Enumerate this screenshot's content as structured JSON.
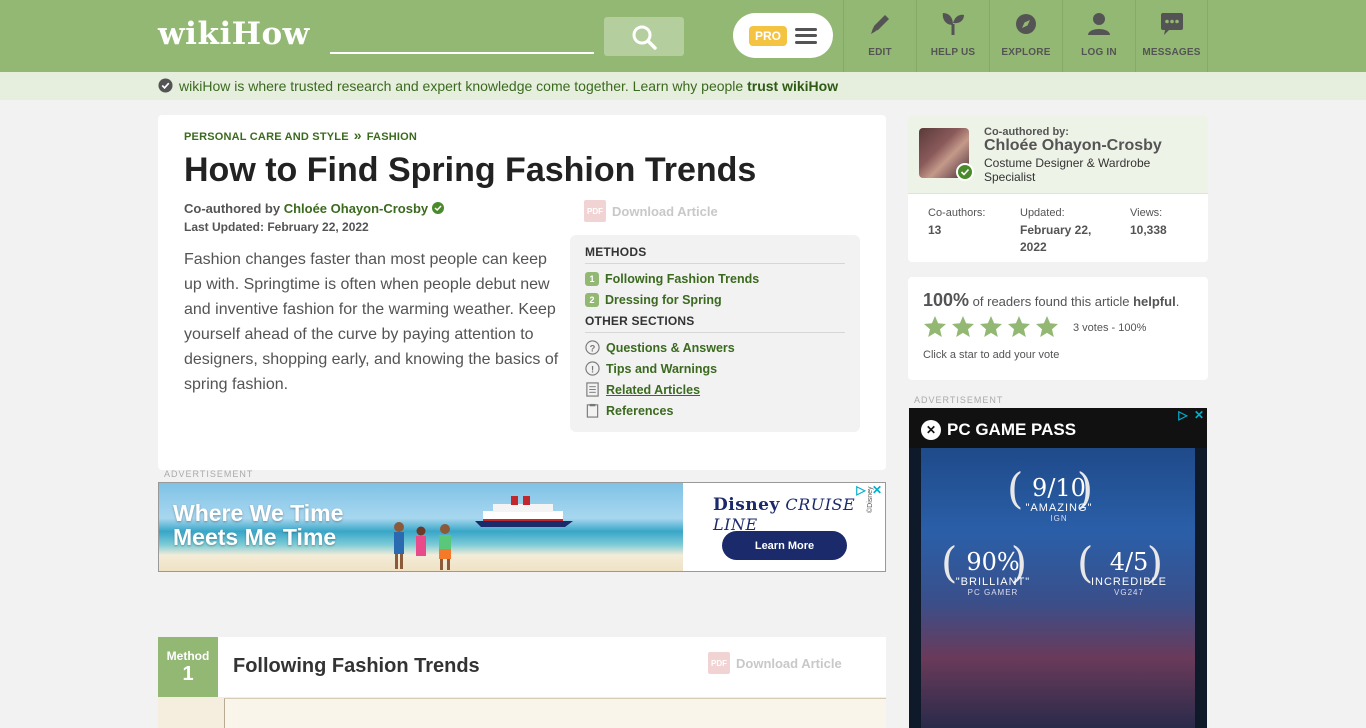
{
  "header": {
    "logo_wiki": "wiki",
    "logo_how": "How",
    "pro_label": "PRO",
    "nav": [
      {
        "label": "EDIT",
        "icon": "pencil-icon"
      },
      {
        "label": "HELP US",
        "icon": "sprout-icon"
      },
      {
        "label": "EXPLORE",
        "icon": "compass-icon"
      },
      {
        "label": "LOG IN",
        "icon": "user-icon"
      },
      {
        "label": "MESSAGES",
        "icon": "chat-icon"
      }
    ]
  },
  "trustbar": {
    "text": "wikiHow is where trusted research and expert knowledge come together. Learn why people ",
    "link": "trust wikiHow"
  },
  "article": {
    "breadcrumb": [
      "PERSONAL CARE AND STYLE",
      "FASHION"
    ],
    "breadcrumb_sep": "»",
    "title": "How to Find Spring Fashion Trends",
    "coauthored_prefix": "Co-authored by",
    "coauthor": "Chloée Ohayon-Crosby",
    "last_updated": "Last Updated: February 22, 2022",
    "intro": "Fashion changes faster than most people can keep up with. Springtime is often when people debut new and inventive fashion for the warming weather. Keep yourself ahead of the curve by paying attention to designers, shopping early, and knowing the basics of spring fashion.",
    "download_label": "Download Article",
    "pdf_label": "PDF"
  },
  "toc": {
    "methods_head": "METHODS",
    "methods": [
      {
        "num": "1",
        "label": "Following Fashion Trends"
      },
      {
        "num": "2",
        "label": "Dressing for Spring"
      }
    ],
    "other_head": "OTHER SECTIONS",
    "other": [
      {
        "label": "Questions & Answers",
        "icon": "question-icon"
      },
      {
        "label": "Tips and Warnings",
        "icon": "exclamation-icon"
      },
      {
        "label": "Related Articles",
        "icon": "document-icon"
      },
      {
        "label": "References",
        "icon": "clipboard-icon"
      }
    ]
  },
  "ads": {
    "label": "ADVERTISEMENT",
    "banner_line1": "Where We Time",
    "banner_line2": "Meets Me Time",
    "brand_disney": "Disney",
    "brand_cruise": "CRUISE LINE",
    "cta": "Learn More",
    "copyright": "©Disney",
    "side_brand": "PC GAME PASS",
    "side_scores": [
      {
        "score": "9/10",
        "quote": "\"AMAZING\"",
        "source": "IGN"
      },
      {
        "score": "90%",
        "quote": "\"BRILLIANT\"",
        "source": "PC GAMER"
      },
      {
        "score": "4/5",
        "quote": "INCREDIBLE",
        "source": "VG247"
      }
    ]
  },
  "method": {
    "label": "Method",
    "number": "1",
    "title": "Following Fashion Trends",
    "download_label": "Download Article"
  },
  "author_card": {
    "coauthored_by": "Co-authored by:",
    "name": "Chloée Ohayon-Crosby",
    "role": "Costume Designer & Wardrobe Specialist",
    "stats": [
      {
        "label": "Co-authors:",
        "value": "13"
      },
      {
        "label": "Updated:",
        "value": "February 22, 2022"
      },
      {
        "label": "Views:",
        "value": "10,338"
      }
    ]
  },
  "rating": {
    "percent": "100%",
    "text_mid": " of readers found this article ",
    "text_bold": "helpful",
    "text_end": ".",
    "stars": 5,
    "votes": "3 votes - 100%",
    "click_hint": "Click a star to add your vote"
  },
  "colors": {
    "brand_green": "#93b874",
    "link_green": "#3b6a1f",
    "pro_yellow": "#f5c342"
  }
}
